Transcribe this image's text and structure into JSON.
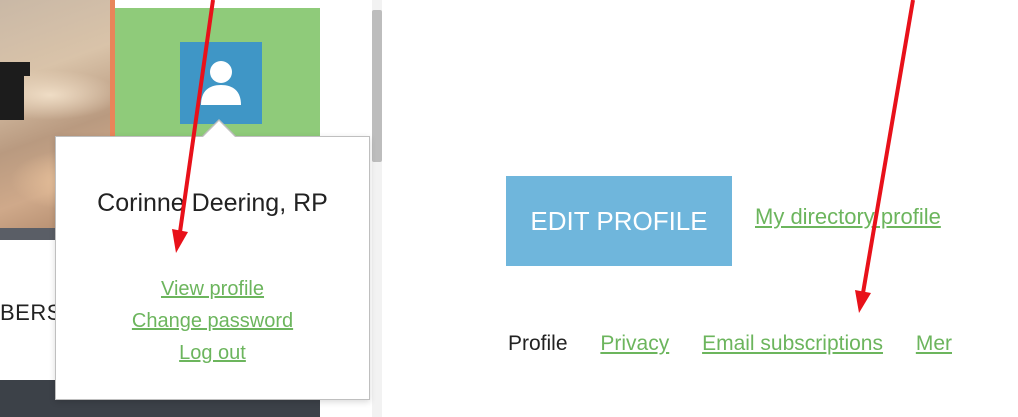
{
  "user_menu": {
    "display_name": "Corinne Deering, RP",
    "links": [
      {
        "label": "View profile"
      },
      {
        "label": "Change password"
      },
      {
        "label": "Log out"
      }
    ]
  },
  "left_nav": {
    "members_text": "BERS"
  },
  "profile_page": {
    "edit_button_label": "EDIT PROFILE",
    "directory_link_label": "My directory profile",
    "tabs": [
      {
        "label": "Profile",
        "active": true
      },
      {
        "label": "Privacy"
      },
      {
        "label": "Email subscriptions"
      },
      {
        "label": "Mer"
      }
    ]
  },
  "icons": {
    "avatar": "user-icon"
  },
  "colors": {
    "link_green": "#6cb55d",
    "button_blue": "#6fb6dc",
    "tile_green": "#8fcb7a",
    "avatar_blue": "#3f96c6",
    "arrow_red": "#e8111a"
  }
}
